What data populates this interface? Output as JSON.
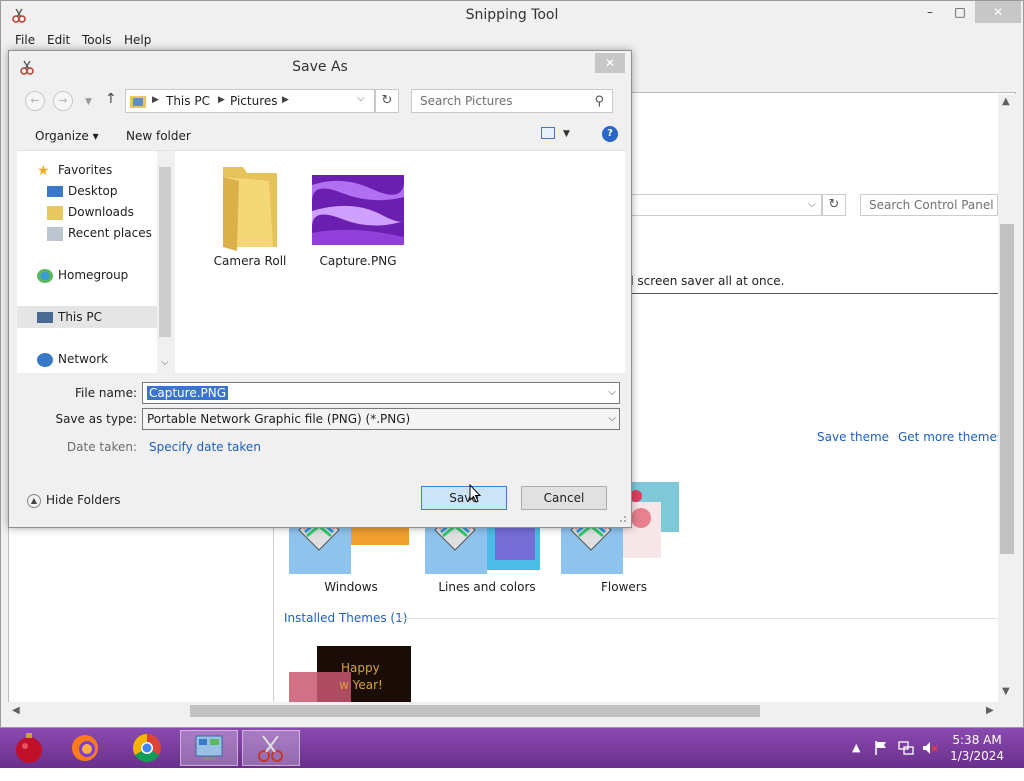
{
  "app": {
    "title": "Snipping Tool",
    "menu": [
      "File",
      "Edit",
      "Tools",
      "Help"
    ],
    "window_controls": {
      "minimize": "–",
      "maximize": "□",
      "close": "✕"
    }
  },
  "background_panel": {
    "search_placeholder": "Search Control Panel",
    "description_fragment": "d screen saver all at once.",
    "links": {
      "save_theme": "Save theme",
      "get_more": "Get more themes c"
    },
    "themes": [
      {
        "label": "Windows"
      },
      {
        "label": "Lines and colors"
      },
      {
        "label": "Flowers"
      }
    ],
    "installed_label": "Installed Themes (1)",
    "installed_thumb_text": "Happy\nw Year!"
  },
  "dialog": {
    "title": "Save As",
    "close": "✕",
    "breadcrumb": [
      "This PC",
      "Pictures"
    ],
    "search_placeholder": "Search Pictures",
    "organize": "Organize",
    "new_folder": "New folder",
    "help": "?",
    "nav": {
      "favorites": "Favorites",
      "desktop": "Desktop",
      "downloads": "Downloads",
      "recent": "Recent places",
      "homegroup": "Homegroup",
      "this_pc": "This PC",
      "network": "Network"
    },
    "files": [
      {
        "name": "Camera Roll",
        "type": "folder"
      },
      {
        "name": "Capture.PNG",
        "type": "image"
      }
    ],
    "file_name_label": "File name:",
    "file_name_value": "Capture.PNG",
    "save_type_label": "Save as type:",
    "save_type_value": "Portable Network Graphic file (PNG) (*.PNG)",
    "date_label": "Date taken:",
    "date_link": "Specify date taken",
    "hide_folders": "Hide Folders",
    "save": "Save",
    "cancel": "Cancel"
  },
  "taskbar": {
    "time": "5:38 AM",
    "date": "1/3/2024"
  },
  "colors": {
    "taskbar": "#7b3f9c",
    "link": "#1f5fbf",
    "selection": "#3a74d1",
    "default_button": "#cde4f7"
  }
}
